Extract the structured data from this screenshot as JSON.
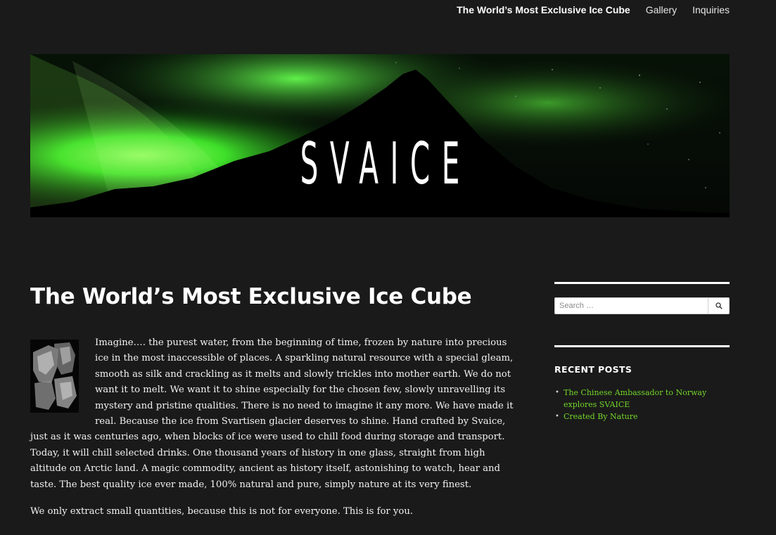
{
  "nav": {
    "items": [
      {
        "label": "The World’s Most Exclusive Ice Cube",
        "current": true
      },
      {
        "label": "Gallery",
        "current": false
      },
      {
        "label": "Inquiries",
        "current": false
      }
    ]
  },
  "header": {
    "site_title": "SVAICE"
  },
  "article": {
    "title": "The World’s Most Exclusive Ice Cube",
    "paragraphs": [
      "Imagine…. the purest water, from the beginning of time, frozen by nature into precious ice in the most inaccessible of places. A sparkling natural resource with a special gleam, smooth as silk and crackling as it melts and slowly trickles into mother earth. We do not want it to melt. We want it to shine especially for the chosen few, slowly unravelling its mystery and pristine qualities. There is no need to imagine it any more. We have made it real. Because the ice from Svartisen glacier deserves to shine. Hand crafted by Svaice, just as it was centuries ago, when blocks of ice were used to chill food during storage and transport. Today, it will chill selected drinks. One thousand years of history in one glass, straight from high altitude on Arctic land. A magic commodity, ancient as history itself, astonishing to watch, hear and taste. The best quality ice ever made, 100% natural and pure, simply nature at its very finest.",
      "We only extract small quantities, because this is not for everyone. This is for you."
    ]
  },
  "sidebar": {
    "search": {
      "placeholder": "Search …",
      "icon": "search-icon"
    },
    "recent_posts": {
      "title": "RECENT POSTS",
      "items": [
        "The Chinese Ambassador to Norway explores SVAICE",
        "Created By Nature"
      ]
    }
  },
  "colors": {
    "background": "#1a1a1a",
    "link_green": "#73d52a",
    "aurora_green": "#3ee02a"
  }
}
